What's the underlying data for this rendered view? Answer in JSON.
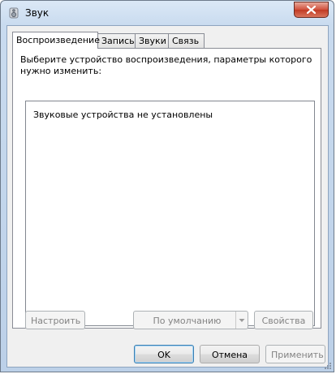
{
  "window": {
    "title": "Звук"
  },
  "tabs": [
    {
      "label": "Воспроизведение",
      "active": true
    },
    {
      "label": "Запись",
      "active": false
    },
    {
      "label": "Звуки",
      "active": false
    },
    {
      "label": "Связь",
      "active": false
    }
  ],
  "panel": {
    "description": "Выберите устройство воспроизведения, параметры которого нужно изменить:",
    "empty_message": "Звуковые устройства не установлены"
  },
  "panel_buttons": {
    "configure": "Настроить",
    "set_default": "По умолчанию",
    "properties": "Свойства"
  },
  "dialog_buttons": {
    "ok": "OK",
    "cancel": "Отмена",
    "apply": "Применить"
  },
  "colors": {
    "frame": "#c9dbef",
    "close_button": "#c13a23",
    "default_button_border": "#3c7fb1"
  }
}
